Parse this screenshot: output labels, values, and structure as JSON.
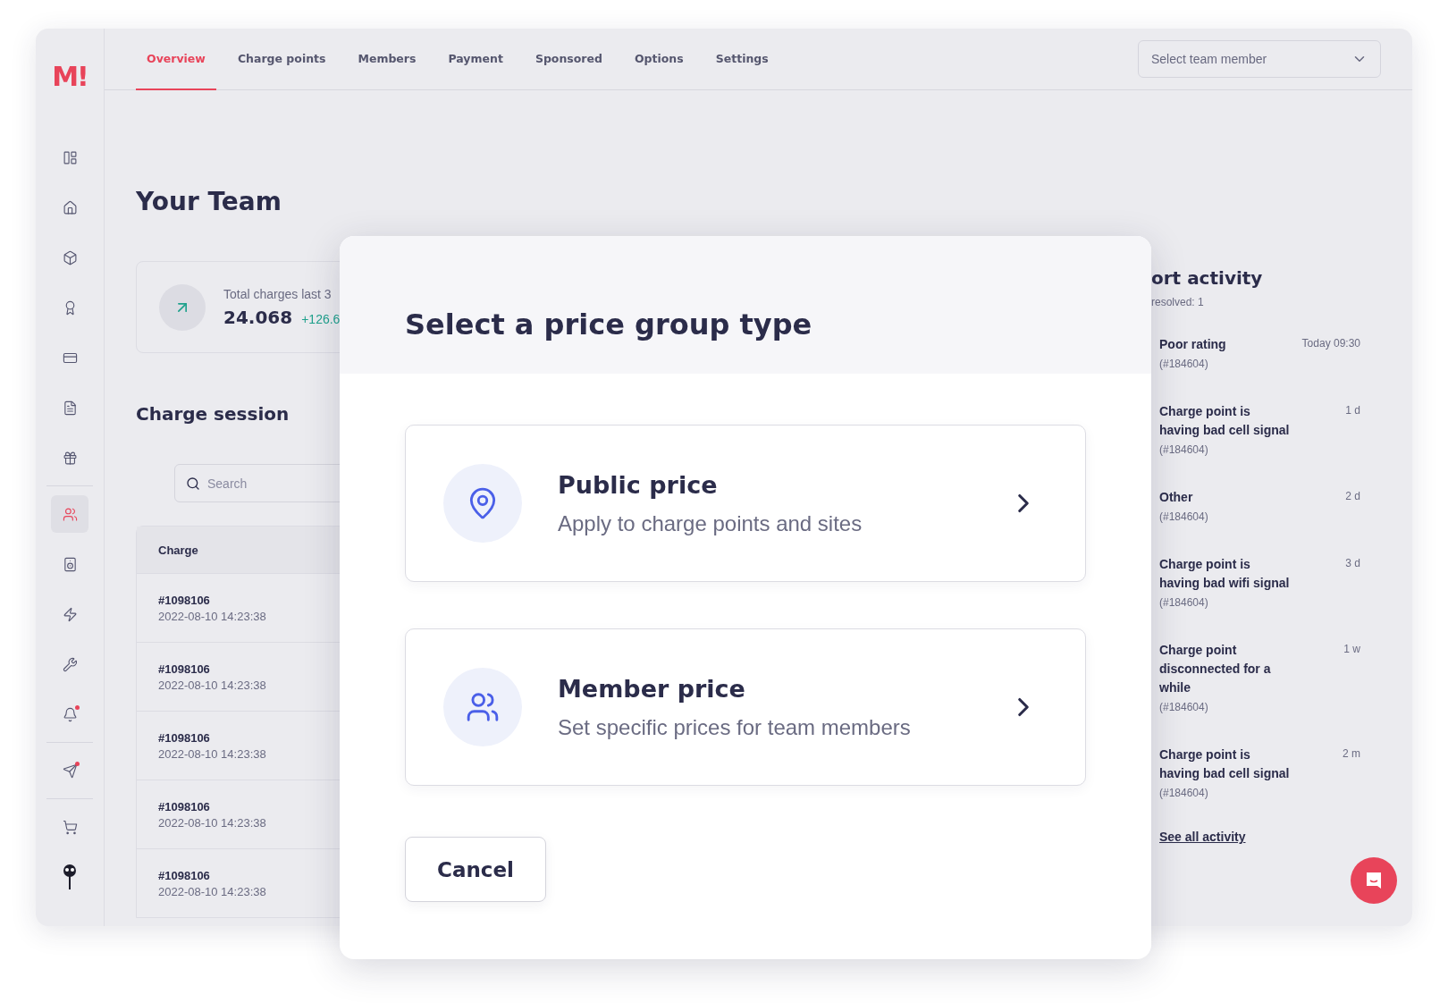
{
  "logo": {
    "text": "M!"
  },
  "nav": {
    "tabs": [
      {
        "label": "Overview",
        "selected": true
      },
      {
        "label": "Charge points",
        "selected": false
      },
      {
        "label": "Members",
        "selected": false
      },
      {
        "label": "Payment",
        "selected": false
      },
      {
        "label": "Sponsored",
        "selected": false
      },
      {
        "label": "Options",
        "selected": false
      },
      {
        "label": "Settings",
        "selected": false
      }
    ],
    "team_select": {
      "placeholder": "Select team member"
    }
  },
  "sidebar": {
    "groups": [
      [
        {
          "selected": false,
          "notification": false
        },
        {
          "selected": false,
          "notification": false
        },
        {
          "selected": false,
          "notification": false
        },
        {
          "selected": false,
          "notification": false
        },
        {
          "selected": false,
          "notification": false
        },
        {
          "selected": false,
          "notification": false
        },
        {
          "selected": false,
          "notification": false
        }
      ],
      [
        {
          "selected": true,
          "notification": false
        },
        {
          "selected": false,
          "notification": false
        },
        {
          "selected": false,
          "notification": false
        },
        {
          "selected": false,
          "notification": false
        },
        {
          "selected": false,
          "notification": true
        }
      ],
      [
        {
          "selected": false,
          "notification": true
        }
      ],
      [
        {
          "selected": false,
          "notification": false
        },
        {
          "selected": false,
          "notification": false
        }
      ]
    ]
  },
  "page_title": "Your Team",
  "stat": {
    "label": "Total charges last 3",
    "value": "24.068",
    "change": "+126.6"
  },
  "charge_session": {
    "title": "Charge session",
    "search": {
      "placeholder": "Search"
    },
    "table": {
      "columns": [
        "Charge"
      ],
      "rows": [
        {
          "id": "#1098106",
          "time": "2022-08-10 14:23:38"
        },
        {
          "id": "#1098106",
          "time": "2022-08-10 14:23:38"
        },
        {
          "id": "#1098106",
          "time": "2022-08-10 14:23:38"
        },
        {
          "id": "#1098106",
          "time": "2022-08-10 14:23:38"
        },
        {
          "id": "#1098106",
          "time": "2022-08-10 14:23:38"
        }
      ]
    }
  },
  "activity": {
    "title": "ort activity",
    "subtitle": "resolved: 1",
    "items": [
      {
        "title": "Poor rating",
        "ref": "(#184604)",
        "time": "Today 09:30"
      },
      {
        "title": "Charge point is having bad cell signal",
        "ref": "(#184604)",
        "time": "1 d"
      },
      {
        "title": "Other",
        "ref": "(#184604)",
        "time": "2 d"
      },
      {
        "title": "Charge point is having bad wifi signal",
        "ref": "(#184604)",
        "time": "3 d"
      },
      {
        "title": "Charge point disconnected for a while",
        "ref": "(#184604)",
        "time": "1 w"
      },
      {
        "title": "Charge point is having bad cell signal",
        "ref": "(#184604)",
        "time": "2 m"
      }
    ],
    "link": "See all activity"
  },
  "modal": {
    "title": "Select a price group type",
    "options": [
      {
        "kind": "location",
        "title": "Public price",
        "subtitle": "Apply to charge points and sites"
      },
      {
        "kind": "members",
        "title": "Member price",
        "subtitle": "Set specific prices for team members"
      }
    ],
    "cancel": "Cancel"
  }
}
